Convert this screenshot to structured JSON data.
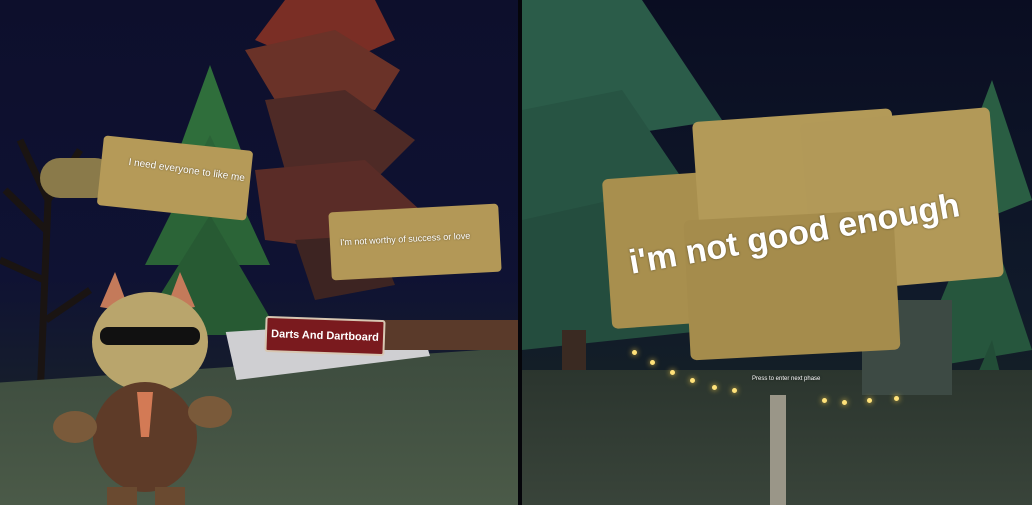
{
  "left_scene": {
    "sign_top_left": "I need everyone to like me",
    "sign_center_right": "I'm not worthy of success or love",
    "booth_label": "Darts And Dartboard"
  },
  "right_scene": {
    "sign_large": "i'm not good enough",
    "prompt_small": "Press to enter next phase"
  },
  "colors": {
    "sky": "#0d0f2c",
    "tree_green": "#2e6b3e",
    "sign_tan": "#b79b56",
    "banner_red": "#7a1a1e"
  }
}
